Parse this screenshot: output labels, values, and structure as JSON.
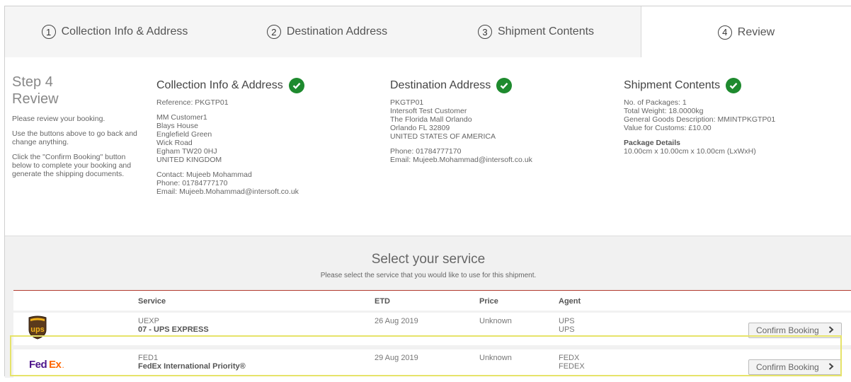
{
  "tabs": [
    {
      "num": "1",
      "label": "Collection Info & Address"
    },
    {
      "num": "2",
      "label": "Destination Address"
    },
    {
      "num": "3",
      "label": "Shipment Contents"
    },
    {
      "num": "4",
      "label": "Review"
    }
  ],
  "step": {
    "title": "Step 4",
    "subtitle": "Review",
    "p1": "Please review your booking.",
    "p2": "Use the buttons above to go back and change anything.",
    "p3": "Click the \"Confirm Booking\" button below to complete your booking and generate the shipping documents."
  },
  "collection": {
    "title": "Collection Info & Address",
    "reference": "Reference: PKGTP01",
    "address": [
      "MM Customer1",
      "Blays House",
      "Englefield Green",
      "Wick Road",
      "Egham TW20 0HJ",
      "UNITED KINGDOM"
    ],
    "contact": "Contact: Mujeeb Mohammad",
    "phone": "Phone: 01784777170",
    "email": "Email: Mujeeb.Mohammad@intersoft.co.uk"
  },
  "destination": {
    "title": "Destination Address",
    "address": [
      "PKGTP01",
      "Intersoft Test Customer",
      "The Florida Mall Orlando",
      "Orlando FL 32809",
      "UNITED STATES OF AMERICA"
    ],
    "phone": "Phone: 01784777170",
    "email": "Email: Mujeeb.Mohammad@intersoft.co.uk"
  },
  "contents": {
    "title": "Shipment Contents",
    "lines": [
      "No. of Packages: 1",
      "Total Weight: 18.0000kg",
      "General Goods Description: MMINTPKGTP01",
      "Value for Customs: £10.00"
    ],
    "pkg_title": "Package Details",
    "pkg_dims": "10.00cm x 10.00cm x 10.00cm (LxWxH)"
  },
  "service": {
    "title": "Select your service",
    "subtitle": "Please select the service that you would like to use for this shipment.",
    "headers": {
      "service": "Service",
      "etd": "ETD",
      "price": "Price",
      "agent": "Agent"
    },
    "rows": [
      {
        "logo": "UPS logo",
        "code": "UEXP",
        "name": "07 - UPS EXPRESS",
        "etd": "26 Aug 2019",
        "price": "Unknown",
        "agent1": "UPS",
        "agent2": "UPS",
        "button": "Confirm Booking"
      },
      {
        "logo": "FedEx logo",
        "code": "FED1",
        "name": "FedEx International Priority®",
        "etd": "29 Aug 2019",
        "price": "Unknown",
        "agent1": "FEDX",
        "agent2": "FEDEX",
        "button": "Confirm Booking"
      }
    ]
  },
  "colors": {
    "check": "#1e8a2e",
    "accent_line": "#b23a2f",
    "highlight": "#e6e36a",
    "ups_brown": "#5b3a1c",
    "ups_gold": "#f2b21a",
    "fedex_purple": "#4d148c",
    "fedex_orange": "#ff6600"
  }
}
